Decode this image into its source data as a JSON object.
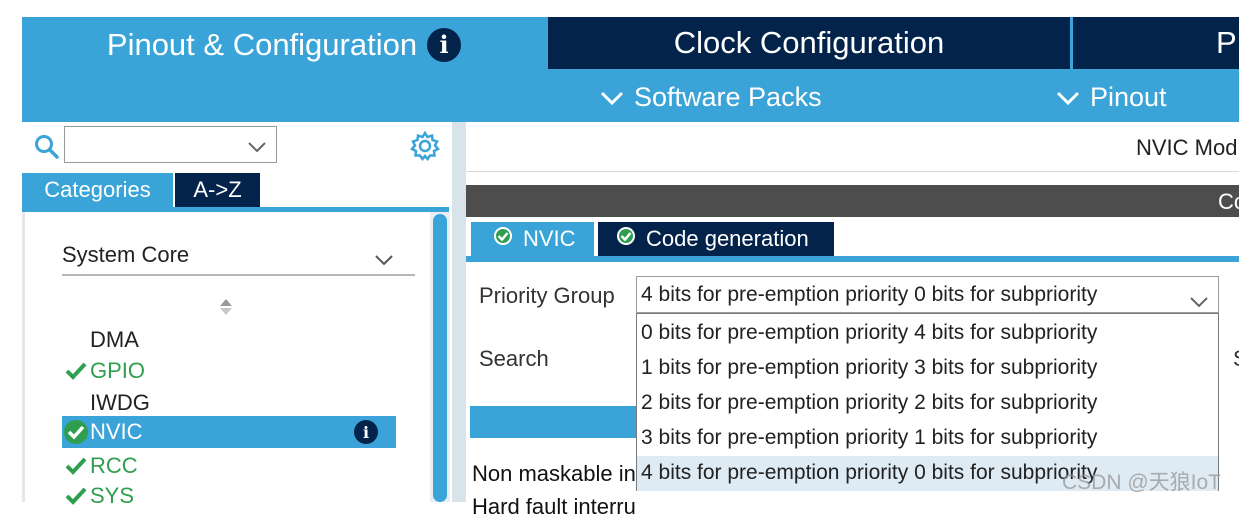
{
  "top_tabs": {
    "pinout": "Pinout & Configuration",
    "clock": "Clock Configuration",
    "project_partial": "P"
  },
  "sub_bar": {
    "software_packs": "Software Packs",
    "pinout": "Pinout"
  },
  "left": {
    "search_value": "",
    "categories_btn": "Categories",
    "az_btn": "A->Z",
    "section": "System Core",
    "items": [
      {
        "label": "DMA",
        "status": "none"
      },
      {
        "label": "GPIO",
        "status": "ok"
      },
      {
        "label": "IWDG",
        "status": "none"
      },
      {
        "label": "NVIC",
        "status": "ok-selected"
      },
      {
        "label": "RCC",
        "status": "ok"
      },
      {
        "label": "SYS",
        "status": "ok"
      }
    ]
  },
  "right": {
    "mode_title": "NVIC Mod",
    "config_title": "Co",
    "tabs": [
      {
        "label": "NVIC"
      },
      {
        "label": "Code generation"
      }
    ],
    "priority_group_label": "Priority Group",
    "priority_group_value": "4 bits for pre-emption priority 0 bits for subpriority",
    "search_label": "Search",
    "right_partial": "S",
    "dropdown_options": [
      "0 bits for pre-emption priority 4 bits for subpriority",
      "1 bits for pre-emption priority 3 bits for subpriority",
      "2 bits for pre-emption priority 2 bits for subpriority",
      "3 bits for pre-emption priority 1 bits for subpriority",
      "4 bits for pre-emption priority 0 bits for subpriority"
    ],
    "highlighted_option_index": 4,
    "rows": [
      "Non maskable interrupt",
      "Hard fault interrupt"
    ]
  },
  "watermark": "CSDN @天狼IoT",
  "colors": {
    "accent": "#3aa4d8",
    "navy": "#03234b",
    "ok_green": "#2f9e4f",
    "dark_bar": "#4d4d4d"
  }
}
